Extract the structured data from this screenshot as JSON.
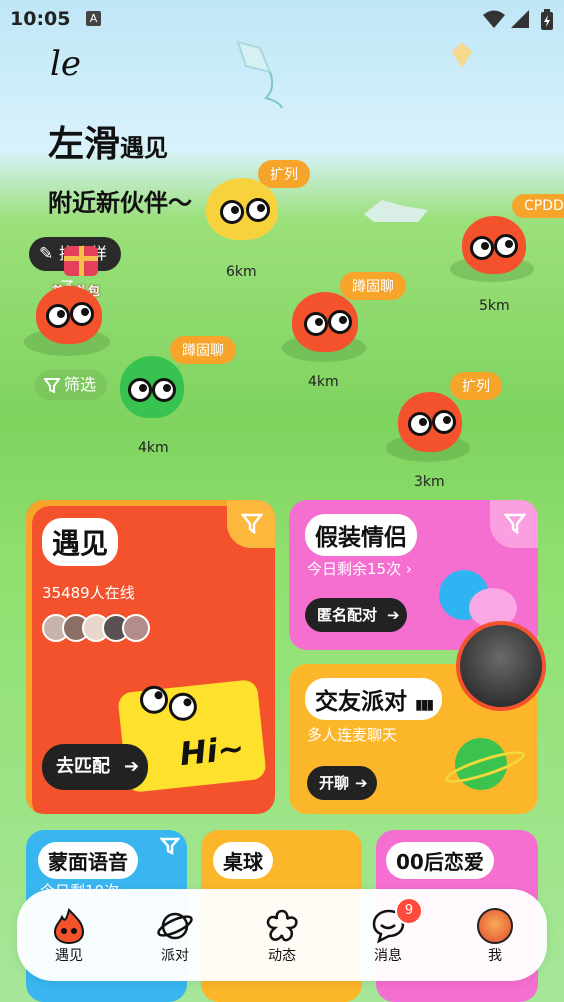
{
  "status": {
    "time": "10:05",
    "notif_icon": "A"
  },
  "logo": "le",
  "headline": {
    "main": "左滑",
    "suffix": "遇见"
  },
  "subline": "附近新伙伴～",
  "side": {
    "edit_label": "换个样子",
    "gift_label": "首充礼包",
    "filter_label": "筛选"
  },
  "map_users": [
    {
      "bubble": "扩列",
      "distance": "6km"
    },
    {
      "bubble": "CPDD",
      "distance": "5km"
    },
    {
      "bubble": "蹲固聊",
      "distance": "4km"
    },
    {
      "bubble": "蹲固聊",
      "distance": "4km"
    },
    {
      "bubble": "扩列",
      "distance": "3km"
    }
  ],
  "cards": {
    "meet": {
      "title": "遇见",
      "online": "35489人在线",
      "button": "去匹配",
      "hi": "Hi~"
    },
    "fake_couple": {
      "title": "假装情侣",
      "subtitle": "今日剩余15次",
      "button": "匿名配对"
    },
    "party": {
      "title": "交友派对",
      "subtitle": "多人连麦聊天",
      "button": "开聊"
    },
    "voice": {
      "title": "蒙面语音",
      "subtitle": "今日剩10次"
    },
    "billiards": {
      "title": "桌球"
    },
    "love00": {
      "title": "00后恋爱"
    }
  },
  "tabs": [
    {
      "label": "遇见"
    },
    {
      "label": "派对"
    },
    {
      "label": "动态"
    },
    {
      "label": "消息",
      "badge": "9"
    },
    {
      "label": "我"
    }
  ],
  "colors": {
    "accent_orange": "#f4522d",
    "pink": "#f56fd1",
    "yellow": "#fcb62a",
    "green": "#7fd35f"
  }
}
